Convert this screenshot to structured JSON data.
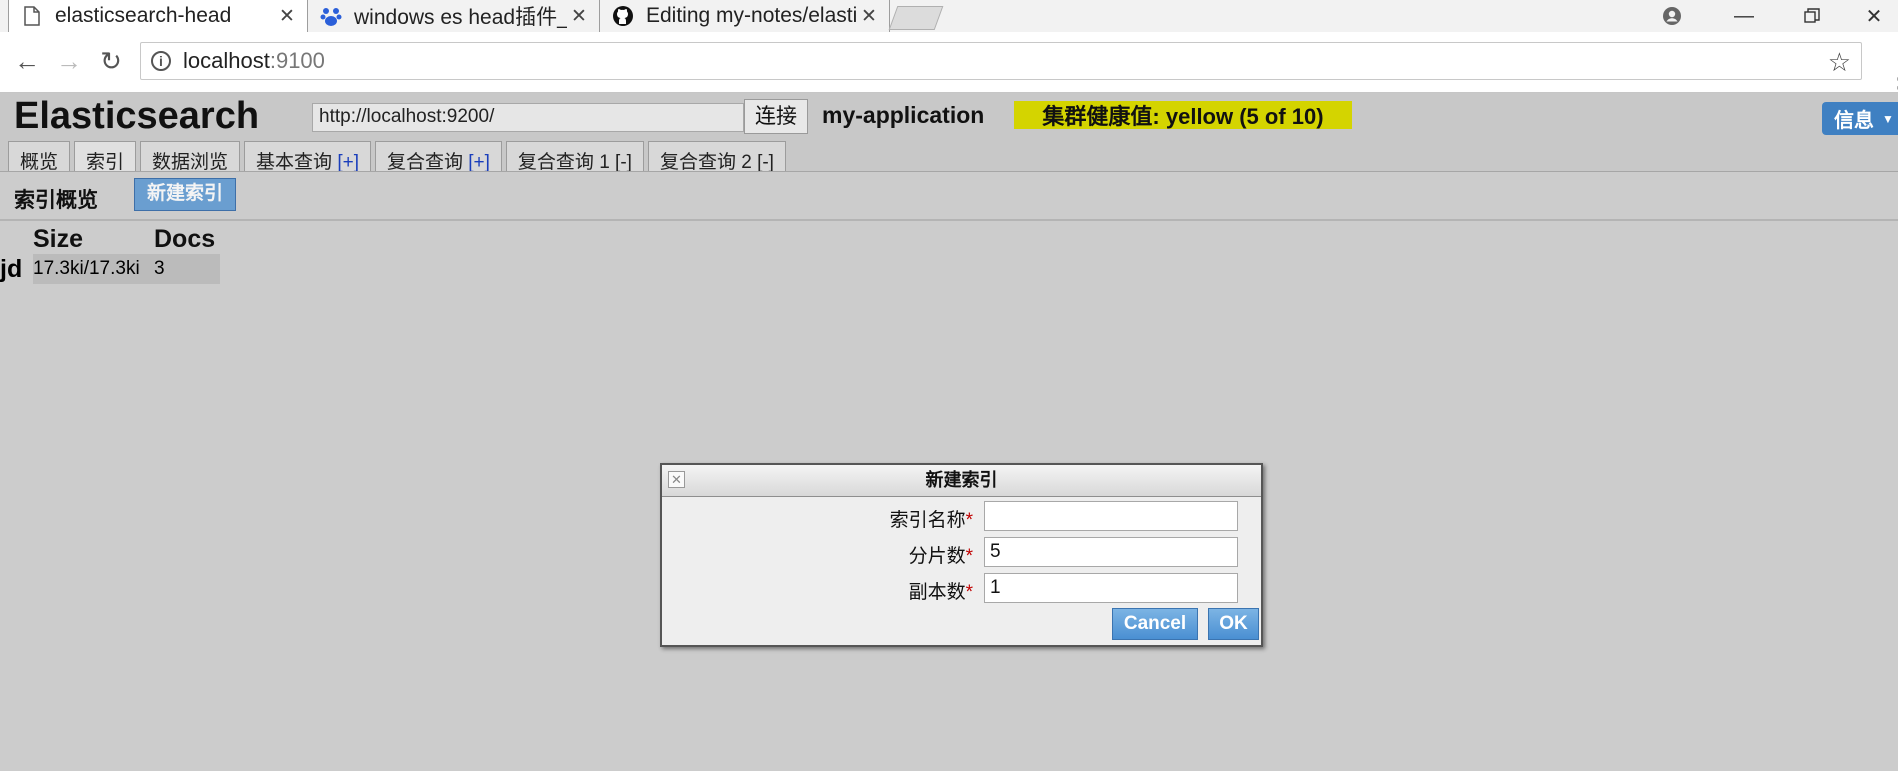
{
  "browser": {
    "tabs": [
      {
        "title": "elasticsearch-head",
        "icon": "document-icon",
        "active": true
      },
      {
        "title": "windows es head插件_百度",
        "icon": "baidu-paw-icon",
        "active": false
      },
      {
        "title": "Editing my-notes/elastic",
        "icon": "github-icon",
        "active": false
      }
    ],
    "address": {
      "host": "localhost",
      "port": ":9100"
    }
  },
  "app": {
    "title": "Elasticsearch",
    "cluster_url": "http://localhost:9200/",
    "connect_label": "连接",
    "cluster_name": "my-application",
    "health_text": "集群健康值: yellow (5 of 10)",
    "info_label": "信息",
    "colors": {
      "health": "#d4d400",
      "accent": "#3f80c2",
      "background": "#cccccc"
    },
    "tabs": [
      {
        "label": "概览",
        "action": ""
      },
      {
        "label": "索引",
        "action": "",
        "active": true
      },
      {
        "label": "数据浏览",
        "action": ""
      },
      {
        "label": "基本查询 ",
        "action": "[+]"
      },
      {
        "label": "复合查询 ",
        "action": "[+]"
      },
      {
        "label": "复合查询 1 ",
        "action": "[-]"
      },
      {
        "label": "复合查询 2 ",
        "action": "[-]"
      }
    ]
  },
  "index_page": {
    "title": "索引概览",
    "new_index_label": "新建索引",
    "columns": [
      "Size",
      "Docs"
    ],
    "rows": [
      {
        "name": "jd",
        "size": "17.3ki/17.3ki",
        "docs": "3"
      }
    ]
  },
  "dialog": {
    "title": "新建索引",
    "fields": [
      {
        "label": "索引名称",
        "required": "*",
        "value": ""
      },
      {
        "label": "分片数",
        "required": "*",
        "value": "5"
      },
      {
        "label": "副本数",
        "required": "*",
        "value": "1"
      }
    ],
    "cancel_label": "Cancel",
    "ok_label": "OK"
  }
}
